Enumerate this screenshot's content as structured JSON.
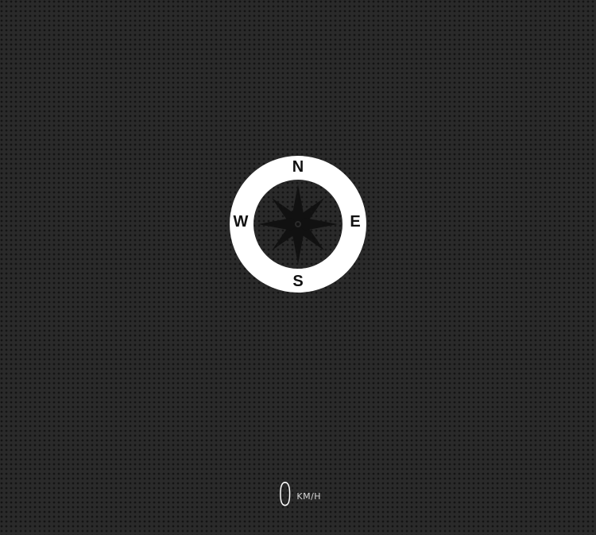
{
  "compass": {
    "north": "N",
    "south": "S",
    "east": "E",
    "west": "W",
    "icon": "compass-rose-icon",
    "ring_color": "#ffffff",
    "rose_color": "#111111"
  },
  "speed": {
    "value": "0",
    "unit": "KM/H"
  },
  "colors": {
    "background": "#2a2a2a",
    "text": "#ffffff"
  }
}
